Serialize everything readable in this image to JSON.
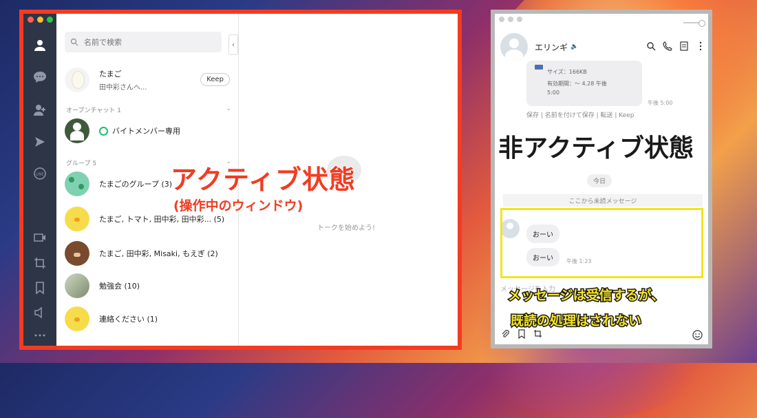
{
  "active_window": {
    "search": {
      "placeholder": "名前で検索"
    },
    "pinned_chat": {
      "name": "たまご",
      "preview": "田中彩さんへ...",
      "keep_label": "Keep"
    },
    "openchat_section": {
      "title": "オープンチャット 1"
    },
    "openchat_item": {
      "name": "バイトメンバー専用"
    },
    "group_section": {
      "title": "グループ 5"
    },
    "groups": [
      {
        "name": "たまごのグループ (3)"
      },
      {
        "name": "たまご, トマト, 田中彩, 田中彩... (5)"
      },
      {
        "name": "たまご, 田中彩, Misaki, もえぎ (2)"
      },
      {
        "name": "勉強会 (10)"
      },
      {
        "name": "連絡ください (1)"
      }
    ],
    "empty_chat_text": "トークを始めよう!",
    "label_title": "アクティブ状態",
    "label_subtitle": "(操作中のウィンドウ)",
    "colors": {
      "border": "#f23c22",
      "rail": "#2d3546"
    }
  },
  "inactive_window": {
    "contact_name": "エリンギ",
    "file_card": {
      "size_line": "サイズ：166KB",
      "expire_line1": "有効期間：～ 4.28 午後",
      "expire_line2": "5:00"
    },
    "file_time": "午後 5:00",
    "file_actions": "保存 | 名前を付けて保存 | 転送 | Keep",
    "today_label": "今日",
    "unread_label": "ここから未読メッセージ",
    "messages": [
      {
        "text": "おーい"
      },
      {
        "text": "おーい",
        "time": "午後 1:23"
      }
    ],
    "input_placeholder": "メッセージを入力",
    "label_title": "非アクティブ状態",
    "caption_line1": "メッセージは受信するが、",
    "caption_line2": "既読の処理はされない",
    "colors": {
      "border": "#b8b8b8",
      "highlight": "#f5e31a"
    }
  }
}
